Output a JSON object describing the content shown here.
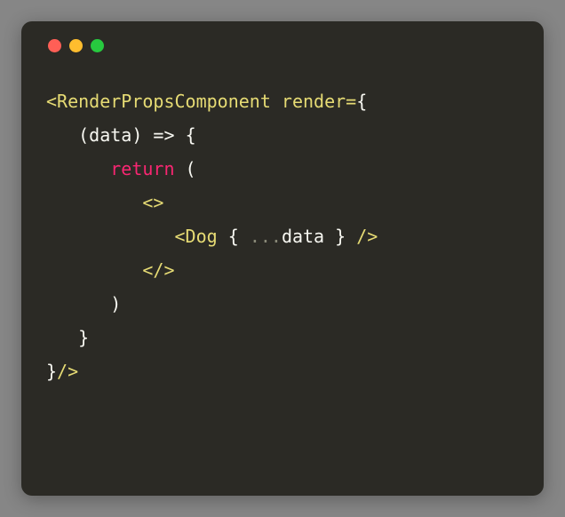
{
  "traffic": {
    "red": "close",
    "yellow": "minimize",
    "green": "zoom"
  },
  "code": {
    "l1": {
      "a": "<RenderPropsComponent render=",
      "b": "{"
    },
    "l2": {
      "a": "   ",
      "b": "(",
      "c": "data",
      "d": ")",
      "e": " => ",
      "f": "{"
    },
    "l3": {
      "a": "      ",
      "b": "return",
      "c": " ("
    },
    "l4": {
      "a": "         ",
      "b": "<>"
    },
    "l5": {
      "a": "            ",
      "b": "<Dog ",
      "c": "{ ",
      "d": "...",
      "e": "data",
      "f": " } ",
      "g": "/>"
    },
    "l6": {
      "a": "         ",
      "b": "</>"
    },
    "l7": {
      "a": "      )"
    },
    "l8": {
      "a": "   ",
      "b": "}"
    },
    "l9": {
      "a": "}",
      "b": "/>"
    }
  }
}
